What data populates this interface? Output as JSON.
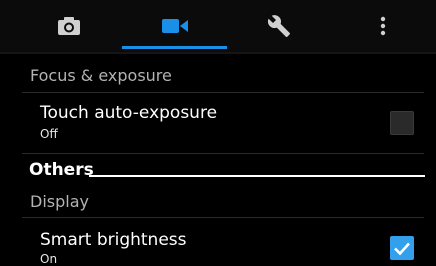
{
  "tabs": [
    {
      "icon": "camera-icon"
    },
    {
      "icon": "video-camera-icon",
      "selected": true
    },
    {
      "icon": "wrench-icon"
    },
    {
      "icon": "more-vert-icon"
    }
  ],
  "colors": {
    "accent": "#1a8fe8",
    "checkbox_on": "#33a0ee",
    "background": "#000000"
  },
  "sections": {
    "focus_exposure": "Focus & exposure",
    "others": "Others",
    "display": "Display"
  },
  "items": {
    "touch_auto_exposure": {
      "title": "Touch auto-exposure",
      "value": "Off",
      "checked": false
    },
    "smart_brightness": {
      "title": "Smart brightness",
      "value": "On",
      "checked": true
    }
  }
}
